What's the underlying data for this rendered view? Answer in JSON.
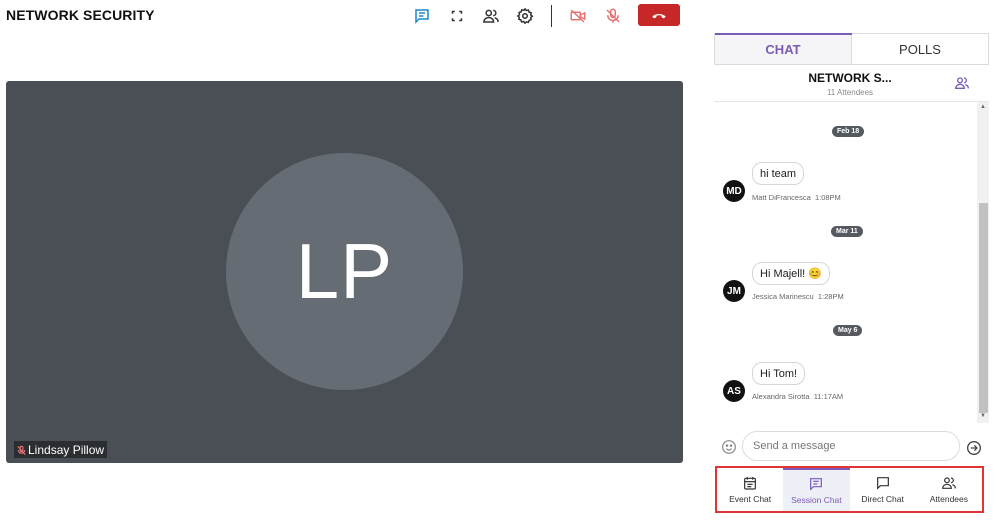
{
  "header": {
    "title": "NETWORK SECURITY",
    "icons": [
      "chat-icon",
      "fullscreen-icon",
      "participants-icon",
      "settings-icon",
      "camera-off-icon",
      "mic-off-icon",
      "end-call-icon"
    ]
  },
  "video": {
    "initials": "LP",
    "participant_name": "Lindsay Pillow",
    "muted": true
  },
  "panel": {
    "tabs": [
      {
        "label": "CHAT",
        "active": true
      },
      {
        "label": "POLLS",
        "active": false
      }
    ],
    "chat_title": "NETWORK S...",
    "attendees_count": "11 Attendees",
    "messages": [
      {
        "date": "Feb 18",
        "initials": "MD",
        "text": "hi team",
        "author": "Matt DiFrancesca",
        "time": "1:08PM"
      },
      {
        "date": "Mar 11",
        "initials": "JM",
        "text": "Hi Majell!",
        "emoji": "😊",
        "author": "Jessica Marinescu",
        "time": "1:28PM"
      },
      {
        "date": "May 6",
        "initials": "AS",
        "text": "Hi Tom!",
        "author": "Alexandra Sirotta",
        "time": "11:17AM"
      }
    ],
    "input_placeholder": "Send a message"
  },
  "bottom_nav": [
    {
      "label": "Event Chat",
      "icon": "calendar-icon",
      "active": false
    },
    {
      "label": "Session Chat",
      "icon": "session-chat-icon",
      "active": true
    },
    {
      "label": "Direct Chat",
      "icon": "direct-chat-icon",
      "active": false
    },
    {
      "label": "Attendees",
      "icon": "attendees-icon",
      "active": false
    }
  ],
  "colors": {
    "accent": "#7b5bb5",
    "end_call": "#c62828",
    "muted_red": "#e57373",
    "toolbar_blue": "#1e88c7",
    "video_bg": "#4a4f55",
    "highlight_border": "#e03535"
  }
}
